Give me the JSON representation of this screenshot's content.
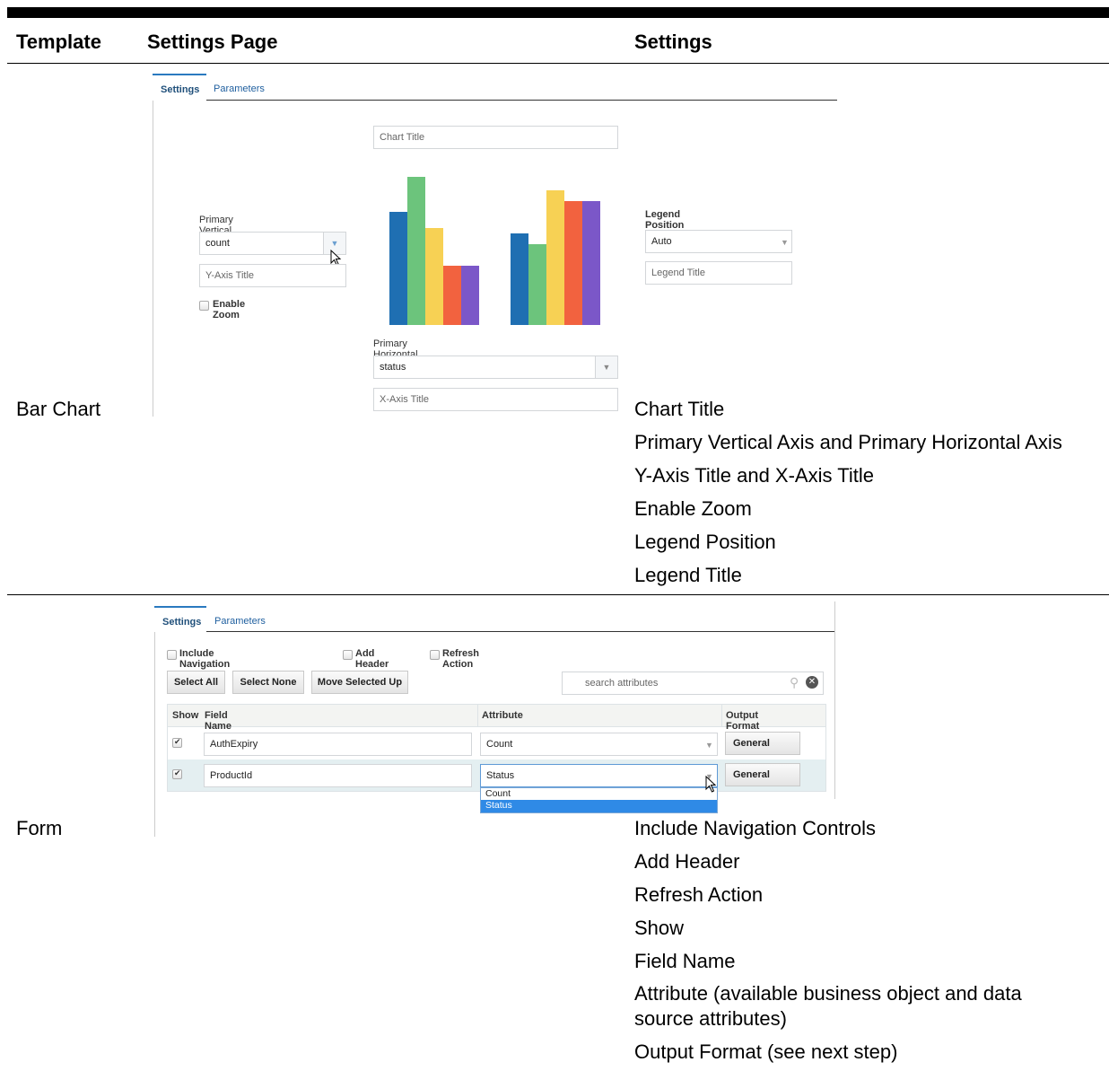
{
  "headers": {
    "template": "Template",
    "settings_page": "Settings Page",
    "settings": "Settings"
  },
  "rows": [
    {
      "template": "Bar Chart",
      "settings": [
        "Chart Title",
        "Primary Vertical Axis and Primary Horizontal Axis",
        "Y-Axis Title and X-Axis Title",
        "Enable Zoom",
        "Legend Position",
        "Legend Title"
      ],
      "screenshot": {
        "tabs": [
          "Settings",
          "Parameters"
        ],
        "chart_title_placeholder": "Chart Title",
        "primary_vertical_axis_label": "Primary Vertical Axis",
        "primary_vertical_axis_value": "count",
        "y_axis_title_placeholder": "Y-Axis Title",
        "enable_zoom_label": "Enable Zoom",
        "primary_horizontal_axis_label": "Primary Horizontal Axis",
        "primary_horizontal_axis_value": "status",
        "x_axis_title_placeholder": "X-Axis Title",
        "legend_position_label": "Legend Position",
        "legend_position_value": "Auto",
        "legend_title_placeholder": "Legend Title",
        "bar_colors": [
          "#1f6fb2",
          "#6cc47c",
          "#f7d154",
          "#f2623f",
          "#7b57c8"
        ]
      }
    },
    {
      "template": "Form",
      "settings": [
        "Include Navigation Controls",
        "Add Header",
        "Refresh Action",
        "Show",
        "Field Name",
        "Attribute (available business object and data source attributes)",
        "Output Format (see next step)"
      ],
      "screenshot": {
        "tabs": [
          "Settings",
          "Parameters"
        ],
        "checkboxes": [
          "Include Navigation Controls",
          "Add Header",
          "Refresh Action"
        ],
        "buttons": [
          "Select All",
          "Select None",
          "Move Selected Up"
        ],
        "search_placeholder": "search attributes",
        "columns": [
          "Show",
          "Field Name",
          "Attribute",
          "Output Format"
        ],
        "table_rows": [
          {
            "field": "AuthExpiry",
            "attribute": "Count",
            "format": "General"
          },
          {
            "field": "ProductId",
            "attribute": "Status",
            "format": "General"
          }
        ],
        "dropdown_options": [
          "Count",
          "Status"
        ]
      }
    }
  ]
}
